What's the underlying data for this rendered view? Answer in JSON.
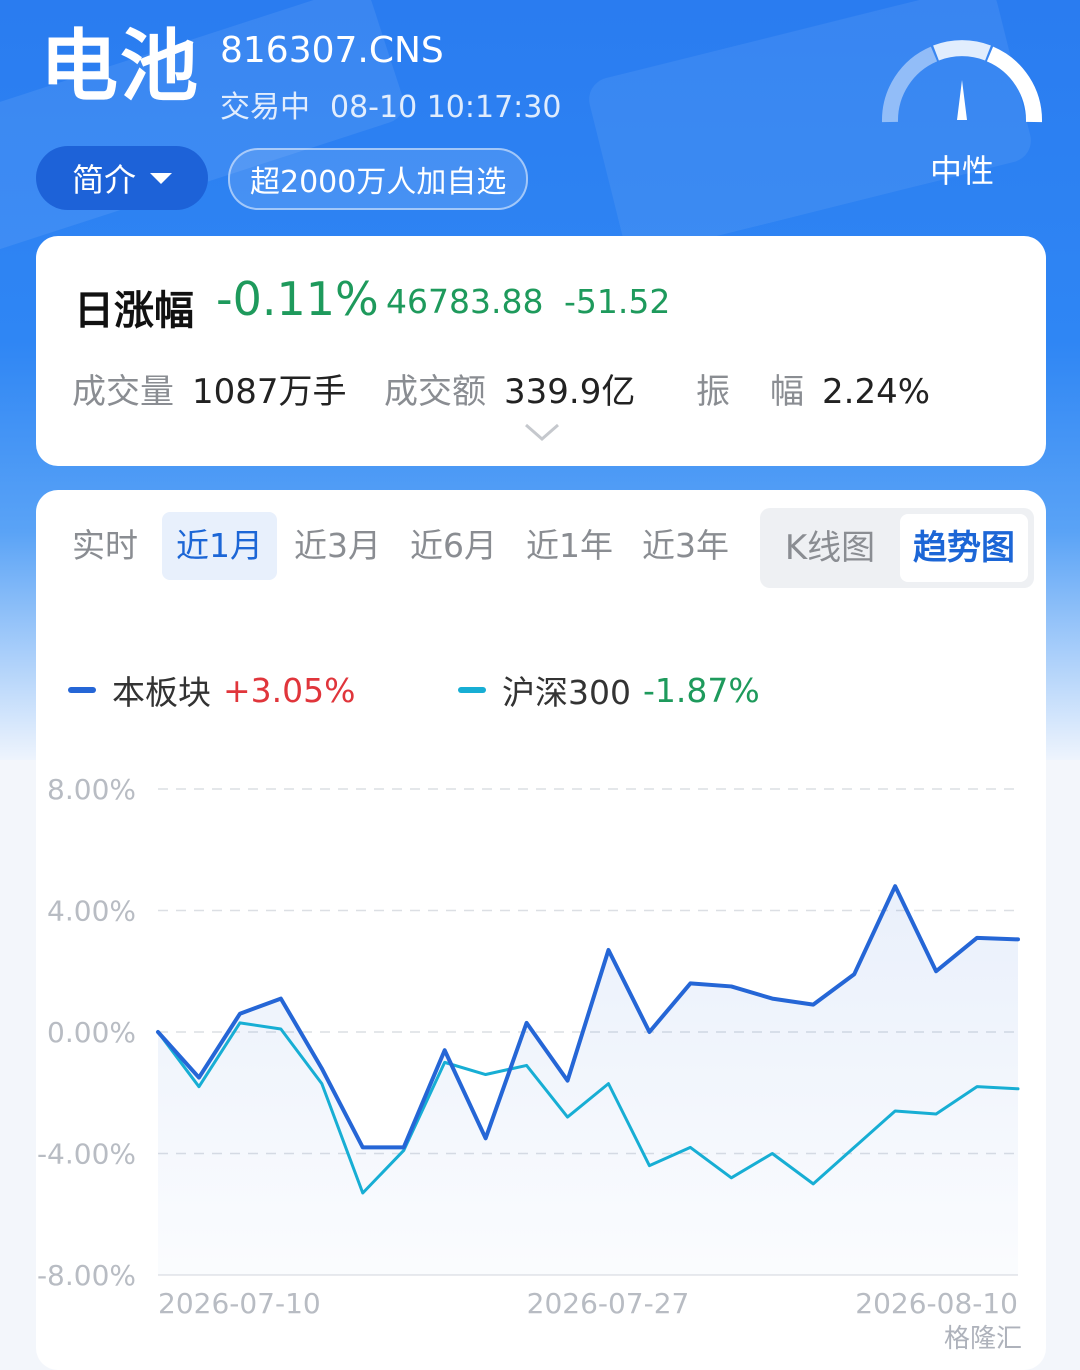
{
  "header": {
    "title": "电池",
    "code": "816307.CNS",
    "trade_status": "交易中",
    "timestamp": "08-10 10:17:30",
    "intro_button": "简介",
    "watch_pill": "超2000万人加自选",
    "sentiment": "中性"
  },
  "quote": {
    "label": "日涨幅",
    "change_pct": "-0.11%",
    "price": "46783.88",
    "change": "-51.52",
    "volume_label": "成交量",
    "volume": "1087万手",
    "amount_label": "成交额",
    "amount": "339.9亿",
    "amplitude_label_1": "振",
    "amplitude_label_2": "幅",
    "amplitude": "2.24%"
  },
  "tabs": [
    "实时",
    "近1月",
    "近3月",
    "近6月",
    "近1年",
    "近3年"
  ],
  "active_tab": "近1月",
  "chart_modes": [
    "K线图",
    "趋势图"
  ],
  "active_mode": "趋势图",
  "legend": [
    {
      "name": "本板块",
      "value": "+3.05%",
      "color": "#2566d6",
      "value_color": "#e0353b"
    },
    {
      "name": "沪深300",
      "value": "-1.87%",
      "color": "#17aed4",
      "value_color": "#1e9a5c"
    }
  ],
  "chart_data": {
    "type": "line",
    "ylim": [
      -8,
      8
    ],
    "yticks": [
      "8.00%",
      "4.00%",
      "0.00%",
      "-4.00%",
      "-8.00%"
    ],
    "xtick_labels": [
      "2026-07-10",
      "2026-07-27",
      "2026-08-10"
    ],
    "grid": true,
    "series": [
      {
        "name": "本板块",
        "color": "#2566d6",
        "values": [
          0.0,
          -1.5,
          0.6,
          1.1,
          -1.2,
          -3.8,
          -3.8,
          -0.6,
          -3.5,
          0.3,
          -1.6,
          2.7,
          0.0,
          1.6,
          1.5,
          1.1,
          0.9,
          1.9,
          4.8,
          2.0,
          3.1,
          3.05
        ]
      },
      {
        "name": "沪深300",
        "color": "#17aed4",
        "values": [
          0.0,
          -1.8,
          0.3,
          0.1,
          -1.7,
          -5.3,
          -3.9,
          -1.0,
          -1.4,
          -1.1,
          -2.8,
          -1.7,
          -4.4,
          -3.8,
          -4.8,
          -4.0,
          -5.0,
          -3.8,
          -2.6,
          -2.7,
          -1.8,
          -1.87
        ]
      }
    ]
  },
  "watermark": "格隆汇"
}
